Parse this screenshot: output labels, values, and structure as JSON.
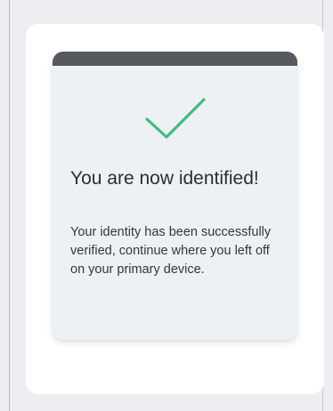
{
  "confirmation": {
    "title": "You are now identified!",
    "message": "Your identity has been successfully verified, continue where you left off on your primary device.",
    "icon": "checkmark-icon",
    "colors": {
      "check": "#3dbd7d",
      "header_bar": "#56595d",
      "card_background": "#eef1f3"
    }
  }
}
